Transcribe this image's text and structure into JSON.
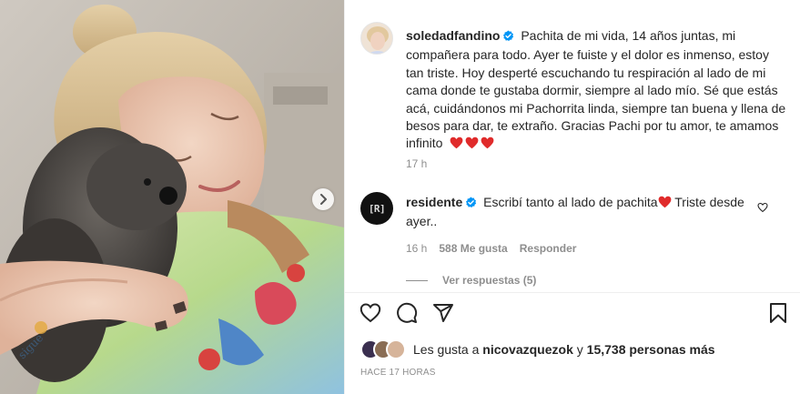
{
  "post": {
    "owner": {
      "username": "soledadfandino",
      "verified_icon": "verified-badge-icon"
    },
    "caption": "Pachita de mi vida, 14 años juntas, mi compañera para todo. Ayer te fuiste y el dolor es inmenso, estoy tan triste. Hoy desperté escuchando tu respiración al lado de mi cama donde te gustaba dormir, siempre al lado mío. Sé que estás acá, cuidándonos mi Pachorrita linda, siempre tan buena y llena de besos para dar, te extraño. Gracias Pachi por tu amor, te amamos infinito",
    "caption_time": "17 h",
    "colors": {
      "accent_verified": "#0095f6",
      "heart": "#e02b2b",
      "muted_text": "#8e8e8e",
      "text": "#262626"
    }
  },
  "comment": {
    "avatar_text": "[R]",
    "username": "residente",
    "text": "Escribí tanto al lado de pachita",
    "text_after": " Triste desde ayer..",
    "time": "16 h",
    "likes": "588 Me gusta",
    "reply_label": "Responder",
    "view_replies": "Ver respuestas (5)"
  },
  "actions": {
    "icons": [
      "heart-outline-icon",
      "comment-bubble-icon",
      "share-paper-plane-icon",
      "bookmark-icon"
    ]
  },
  "likes": {
    "prefix": "Les gusta a",
    "user": "nicovazquezok",
    "middle": "y",
    "count": "15,738 personas más"
  },
  "posted": "HACE 17 HORAS"
}
